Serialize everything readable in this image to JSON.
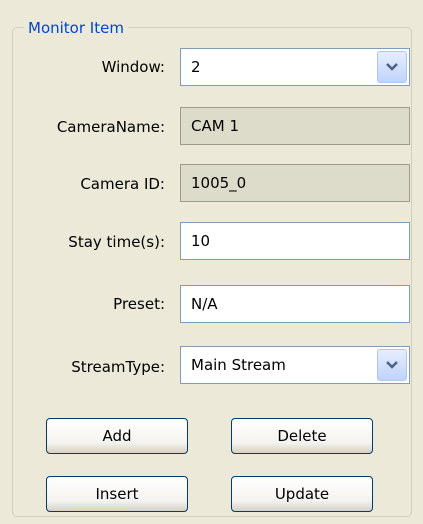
{
  "group": {
    "title": "Monitor Item"
  },
  "window": {
    "label": "Window:",
    "value": "2"
  },
  "camera_name": {
    "label": "CameraName:",
    "value": "CAM 1"
  },
  "camera_id": {
    "label": "Camera ID:",
    "value": "1005_0"
  },
  "stay_time": {
    "label": "Stay time(s):",
    "value": "10"
  },
  "preset": {
    "label": "Preset:",
    "value": "N/A"
  },
  "stream_type": {
    "label": "StreamType:",
    "value": "Main Stream"
  },
  "buttons": {
    "add": "Add",
    "delete": "Delete",
    "insert": "Insert",
    "update": "Update"
  },
  "icons": {
    "dropdown": "chevron-down-icon"
  },
  "colors": {
    "legend": "#0046d5",
    "background": "#ece9d8",
    "readonly_field": "#dddbc9"
  }
}
